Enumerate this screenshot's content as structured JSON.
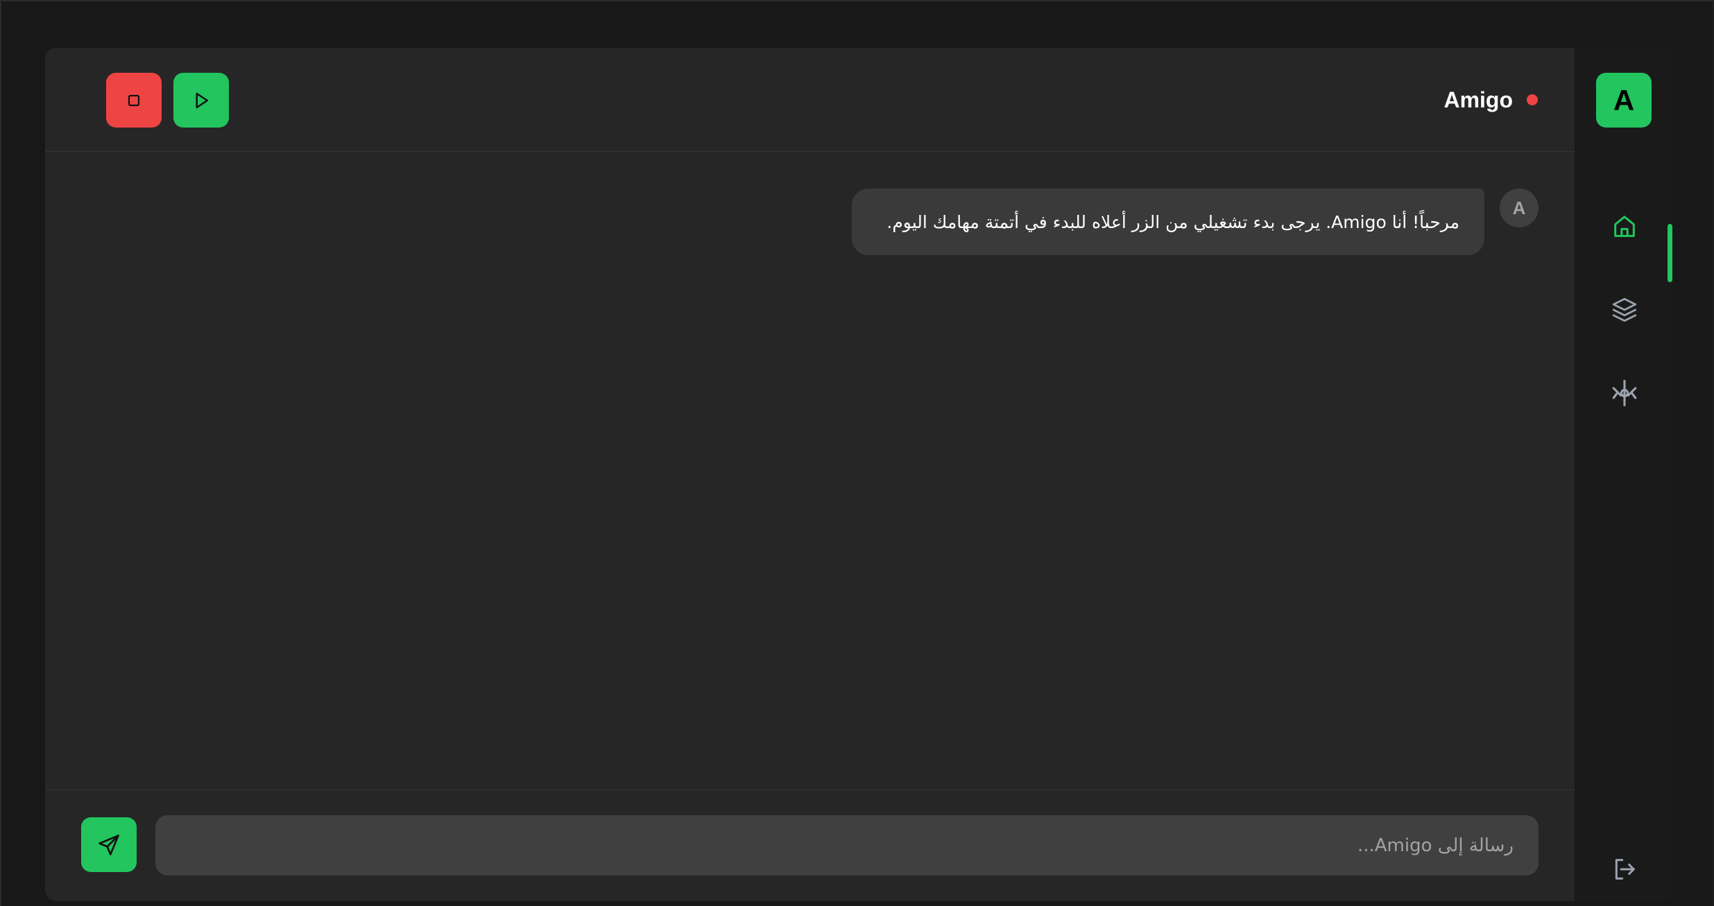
{
  "app": {
    "name": "Amigo",
    "brand_letter": "A",
    "status": "offline",
    "colors": {
      "accent": "#22c55e",
      "danger": "#ef4444",
      "panel": "#262626",
      "sidebar": "#1a1a1a",
      "bubble": "#3a3a3a"
    }
  },
  "header": {
    "title": "Amigo",
    "status_dot_color": "#ef4444",
    "controls": [
      {
        "id": "stop",
        "icon": "stop-icon"
      },
      {
        "id": "start",
        "icon": "play-icon"
      }
    ]
  },
  "messages": [
    {
      "sender_initial": "A",
      "text": "مرحباً! أنا Amigo. يرجى بدء تشغيلي من الزر أعلاه للبدء في أتمتة مهامك اليوم."
    }
  ],
  "composer": {
    "placeholder": "رسالة إلى Amigo...",
    "value": "",
    "send_icon": "send-icon"
  },
  "sidebar": {
    "brand_letter": "A",
    "items": [
      {
        "id": "home",
        "icon": "home-icon",
        "active": true
      },
      {
        "id": "layers",
        "icon": "layers-icon",
        "active": false
      },
      {
        "id": "flows",
        "icon": "branch-icon",
        "active": false
      }
    ],
    "logout_icon": "logout-icon"
  }
}
